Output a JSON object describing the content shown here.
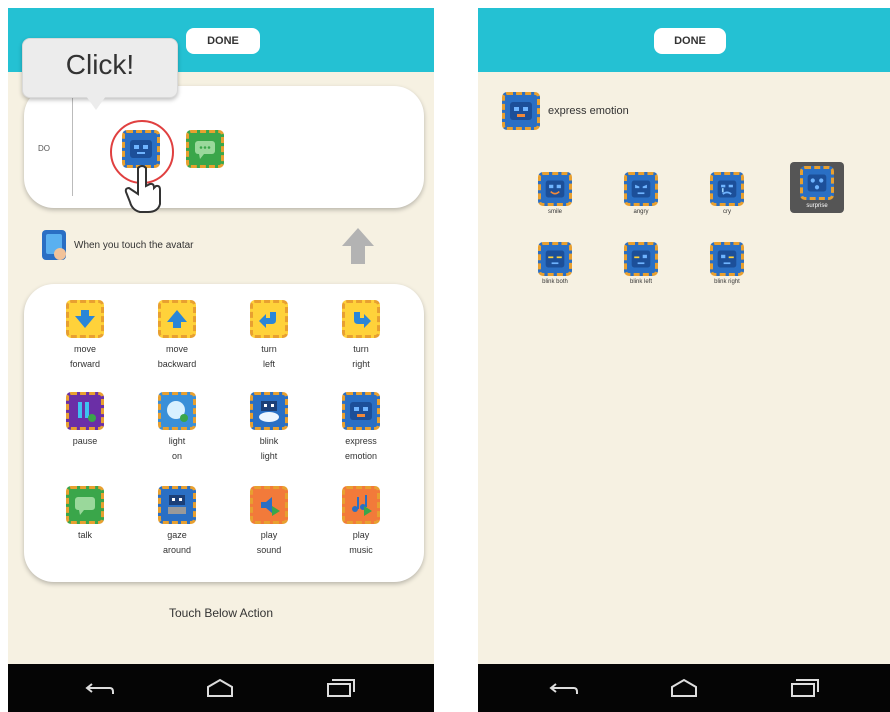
{
  "left_screen": {
    "done_label": "DONE",
    "callout_text": "Click!",
    "do_label": "DO",
    "touch_text": "When you touch the avatar",
    "footer_text": "Touch Below Action",
    "actions": [
      {
        "label": "move\nforward",
        "icon": "move-forward-icon"
      },
      {
        "label": "move\nbackward",
        "icon": "move-backward-icon"
      },
      {
        "label": "turn\nleft",
        "icon": "turn-left-icon"
      },
      {
        "label": "turn\nright",
        "icon": "turn-right-icon"
      },
      {
        "label": "pause",
        "icon": "pause-icon"
      },
      {
        "label": "light\non",
        "icon": "light-icon"
      },
      {
        "label": "blink\nlight",
        "icon": "blink-light-icon"
      },
      {
        "label": "express\nemotion",
        "icon": "express-emotion-icon"
      },
      {
        "label": "talk",
        "icon": "talk-icon"
      },
      {
        "label": "gaze\naround",
        "icon": "gaze-icon"
      },
      {
        "label": "play\nsound",
        "icon": "sound-icon"
      },
      {
        "label": "play\nmusic",
        "icon": "music-icon"
      }
    ]
  },
  "right_screen": {
    "done_label": "DONE",
    "heading": "express emotion",
    "emotions": [
      {
        "label": "smile"
      },
      {
        "label": "angry"
      },
      {
        "label": "cry"
      },
      {
        "label": "surprise",
        "selected": true
      },
      {
        "label": "blink both"
      },
      {
        "label": "blink left"
      },
      {
        "label": "blink right"
      }
    ]
  },
  "colors": {
    "topbar": "#24c1d3",
    "background": "#f6f1e2",
    "navbar": "#050505",
    "block_border": "#e8a030"
  }
}
